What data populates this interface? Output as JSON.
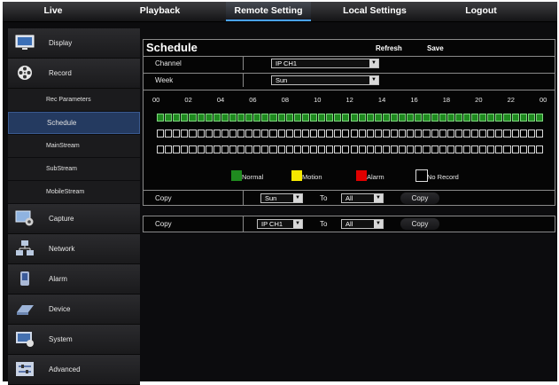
{
  "nav": {
    "tabs": [
      "Live",
      "Playback",
      "Remote Setting",
      "Local Settings",
      "Logout"
    ],
    "active": "Remote Setting"
  },
  "sidebar": {
    "items": [
      {
        "label": "Display",
        "icon": "monitor-icon"
      },
      {
        "label": "Record",
        "icon": "film-reel-icon"
      },
      {
        "label": "Capture",
        "icon": "capture-gear-icon"
      },
      {
        "label": "Network",
        "icon": "network-icon"
      },
      {
        "label": "Alarm",
        "icon": "alarm-icon"
      },
      {
        "label": "Device",
        "icon": "device-disk-icon"
      },
      {
        "label": "System",
        "icon": "system-icon"
      },
      {
        "label": "Advanced",
        "icon": "advanced-sliders-icon"
      }
    ],
    "record_sub": [
      "Rec Parameters",
      "Schedule",
      "MainStream",
      "SubStream",
      "MobileStream"
    ],
    "active_sub": "Schedule"
  },
  "schedule": {
    "title": "Schedule",
    "refresh": "Refresh",
    "save": "Save",
    "channel_label": "Channel",
    "channel_value": "IP CH1",
    "week_label": "Week",
    "week_value": "Sun",
    "hour_labels": [
      "00",
      "02",
      "04",
      "06",
      "08",
      "10",
      "12",
      "14",
      "16",
      "18",
      "20",
      "22",
      "00"
    ],
    "rows": [
      {
        "type": "normal",
        "cells": 48
      },
      {
        "type": "none",
        "cells": 48
      },
      {
        "type": "none",
        "cells": 48
      }
    ],
    "legend": [
      {
        "label": "Normal",
        "color": "#1f8a1f"
      },
      {
        "label": "Motion",
        "color": "#f5e800"
      },
      {
        "label": "Alarm",
        "color": "#e00000"
      },
      {
        "label": "No Record",
        "color": "#000000"
      }
    ],
    "copy1": {
      "label": "Copy",
      "from": "Sun",
      "to_label": "To",
      "to": "All",
      "button": "Copy"
    }
  },
  "copy2": {
    "label": "Copy",
    "from": "IP CH1",
    "to_label": "To",
    "to": "All",
    "button": "Copy"
  },
  "colors": {
    "accent": "#4aa3ff",
    "normal_green": "#1f8a1f",
    "active_sub_bg": "#243a60"
  }
}
